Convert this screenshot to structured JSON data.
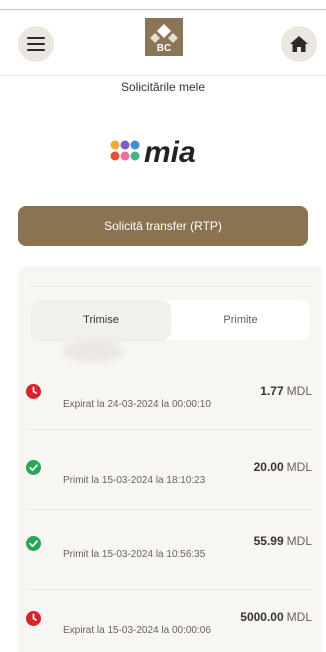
{
  "header": {
    "title": "Solicitările mele",
    "menu_icon": "hamburger-menu-icon",
    "home_icon": "home-icon",
    "logo": "bank-logo"
  },
  "brand": {
    "wordmark": "mia",
    "colors": [
      "#f2a93b",
      "#e34f3c",
      "#7b5fc7",
      "#3f8ed8",
      "#4ab18a",
      "#f06ea0"
    ]
  },
  "actions": {
    "rtp_button": "Solicită transfer (RTP)"
  },
  "tabs": [
    {
      "label": "Trimise",
      "selected": true
    },
    {
      "label": "Primite",
      "selected": false
    }
  ],
  "requests": [
    {
      "status": "expired",
      "status_text": "Expirat la 24-03-2024 la 00:00:10",
      "amount": "1.77",
      "currency": "MDL"
    },
    {
      "status": "received",
      "status_text": "Primit la 15-03-2024 la 18:10:23",
      "amount": "20.00",
      "currency": "MDL"
    },
    {
      "status": "received",
      "status_text": "Primit la 15-03-2024 la 10:56:35",
      "amount": "55.99",
      "currency": "MDL"
    },
    {
      "status": "expired",
      "status_text": "Expirat la 15-03-2024 la 00:00:06",
      "amount": "5000.00",
      "currency": "MDL"
    }
  ],
  "colors": {
    "accent": "#8b7352",
    "expired": "#d8232a",
    "received": "#27a558"
  }
}
